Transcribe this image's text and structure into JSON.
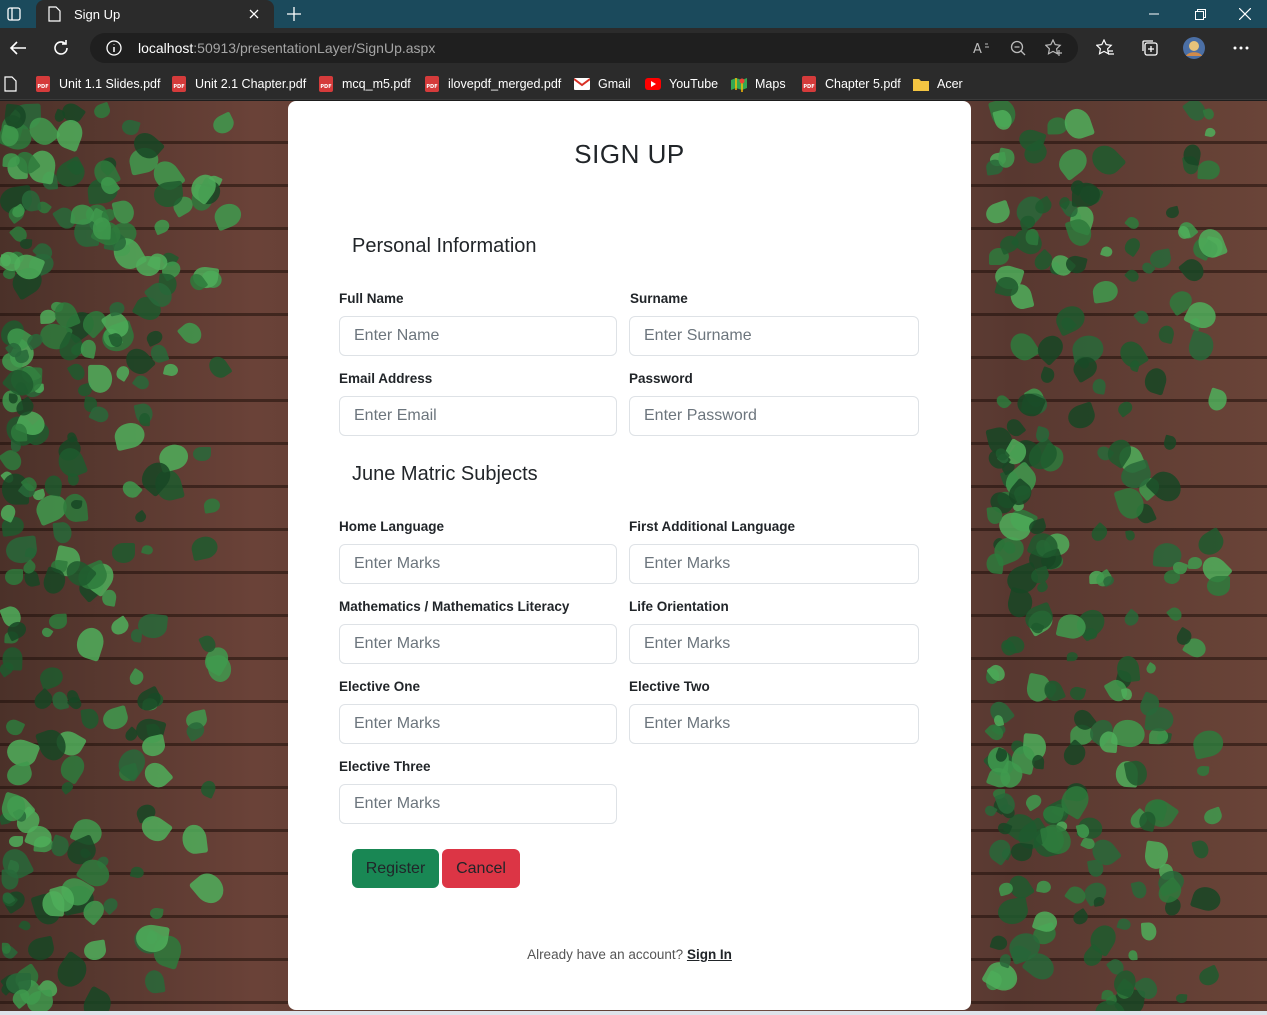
{
  "browser": {
    "tab_title": "Sign Up",
    "url_host": "localhost",
    "url_rest": ":50913/presentationLayer/SignUp.aspx",
    "bookmarks": [
      {
        "label": "Unit 1.1 Slides.pdf",
        "icon": "pdf-icon"
      },
      {
        "label": "Unit 2.1 Chapter.pdf",
        "icon": "pdf-icon"
      },
      {
        "label": "mcq_m5.pdf",
        "icon": "pdf-icon"
      },
      {
        "label": "ilovepdf_merged.pdf",
        "icon": "pdf-icon"
      },
      {
        "label": "Gmail",
        "icon": "gmail-icon"
      },
      {
        "label": "YouTube",
        "icon": "youtube-icon"
      },
      {
        "label": "Maps",
        "icon": "maps-icon"
      },
      {
        "label": "Chapter 5.pdf",
        "icon": "pdf-icon"
      },
      {
        "label": "Acer",
        "icon": "folder-icon"
      }
    ]
  },
  "form": {
    "title": "SIGN UP",
    "personal_heading": "Personal Information",
    "subjects_heading": "June Matric Subjects",
    "full_name": {
      "label": "Full Name",
      "placeholder": "Enter Name",
      "value": ""
    },
    "surname": {
      "label": "Surname",
      "placeholder": "Enter Surname",
      "value": ""
    },
    "email": {
      "label": "Email Address",
      "placeholder": "Enter Email",
      "value": ""
    },
    "password": {
      "label": "Password",
      "placeholder": "Enter Password",
      "value": ""
    },
    "home_language": {
      "label": "Home Language",
      "placeholder": "Enter Marks",
      "value": ""
    },
    "first_additional_language": {
      "label": "First Additional Language",
      "placeholder": "Enter Marks",
      "value": ""
    },
    "mathematics": {
      "label": "Mathematics / Mathematics Literacy",
      "placeholder": "Enter Marks",
      "value": ""
    },
    "life_orientation": {
      "label": "Life Orientation",
      "placeholder": "Enter Marks",
      "value": ""
    },
    "elective_one": {
      "label": "Elective One",
      "placeholder": "Enter Marks",
      "value": ""
    },
    "elective_two": {
      "label": "Elective Two",
      "placeholder": "Enter Marks",
      "value": ""
    },
    "elective_three": {
      "label": "Elective Three",
      "placeholder": "Enter Marks",
      "value": ""
    },
    "register_label": "Register",
    "cancel_label": "Cancel",
    "signin_prompt": "Already have an account?",
    "signin_link": "Sign In"
  },
  "colors": {
    "register": "#198754",
    "cancel": "#dc3545",
    "titlebar": "#1b4a5c",
    "chrome": "#2b2b2b"
  }
}
